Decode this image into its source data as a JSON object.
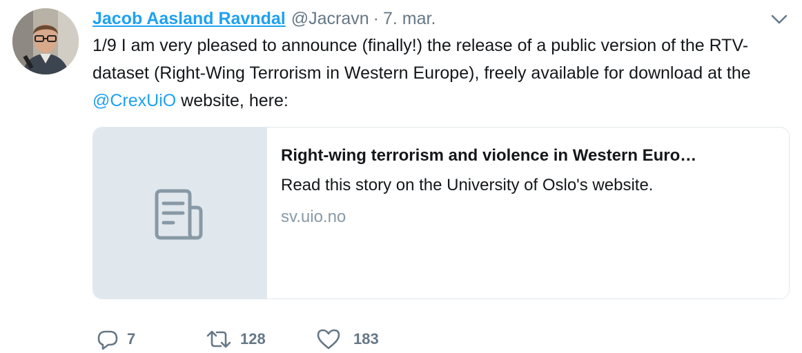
{
  "tweet": {
    "author_name": "Jacob Aasland Ravndal",
    "handle": "@Jacravn",
    "separator": "·",
    "date": "7. mar.",
    "text_before_mention": "1/9 I am very pleased to announce (finally!) the release of a public version of the RTV-dataset (Right-Wing Terrorism in Western Europe), freely available for download at the ",
    "mention": "@CrexUiO",
    "text_after_mention": " website, here:"
  },
  "card": {
    "title": "Right-wing terrorism and violence in Western Euro…",
    "description": "Read this story on the University of Oslo's website.",
    "domain": "sv.uio.no",
    "media_icon": "document-icon"
  },
  "actions": {
    "reply_count": "7",
    "retweet_count": "128",
    "like_count": "183"
  },
  "colors": {
    "link": "#1da1f2",
    "muted": "#657786",
    "card_media_bg": "#e1e8ed",
    "icon_gray": "#8899a6"
  }
}
